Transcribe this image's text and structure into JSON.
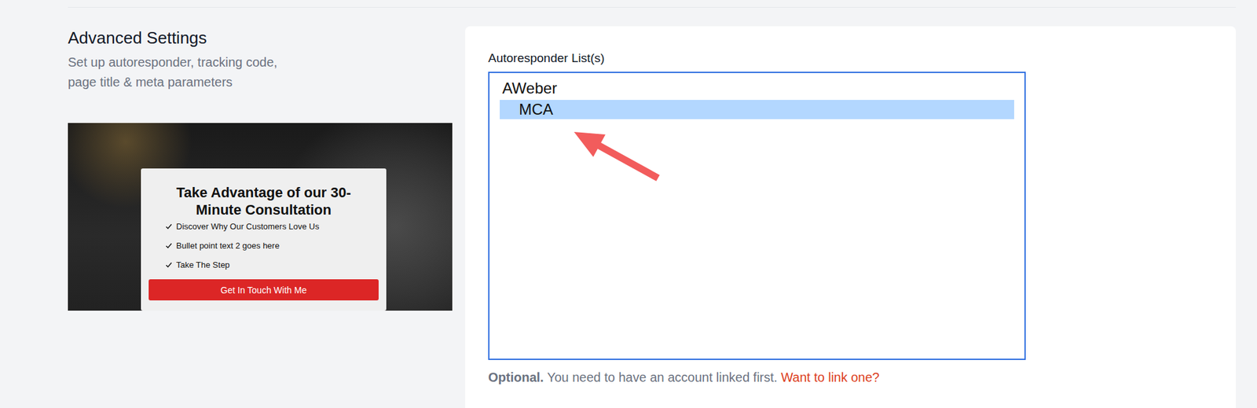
{
  "section": {
    "title": "Advanced Settings",
    "subtitle_lines": [
      "Set up autoresponder, tracking code,",
      "page title & meta parameters"
    ]
  },
  "preview": {
    "heading": "Take Advantage of our 30-Minute Consultation",
    "bullets": [
      "Discover Why Our Customers Love Us",
      "Bullet point text 2 goes here",
      "Take The Step"
    ],
    "button": "Get In Touch With Me"
  },
  "field": {
    "label": "Autoresponder List(s)",
    "options": [
      {
        "label": "AWeber",
        "kind": "group",
        "selected": false
      },
      {
        "label": "MCA",
        "kind": "option",
        "selected": true
      }
    ],
    "help": {
      "strong": "Optional.",
      "text": "You need to have an account linked first.",
      "link": "Want to link one?"
    }
  }
}
